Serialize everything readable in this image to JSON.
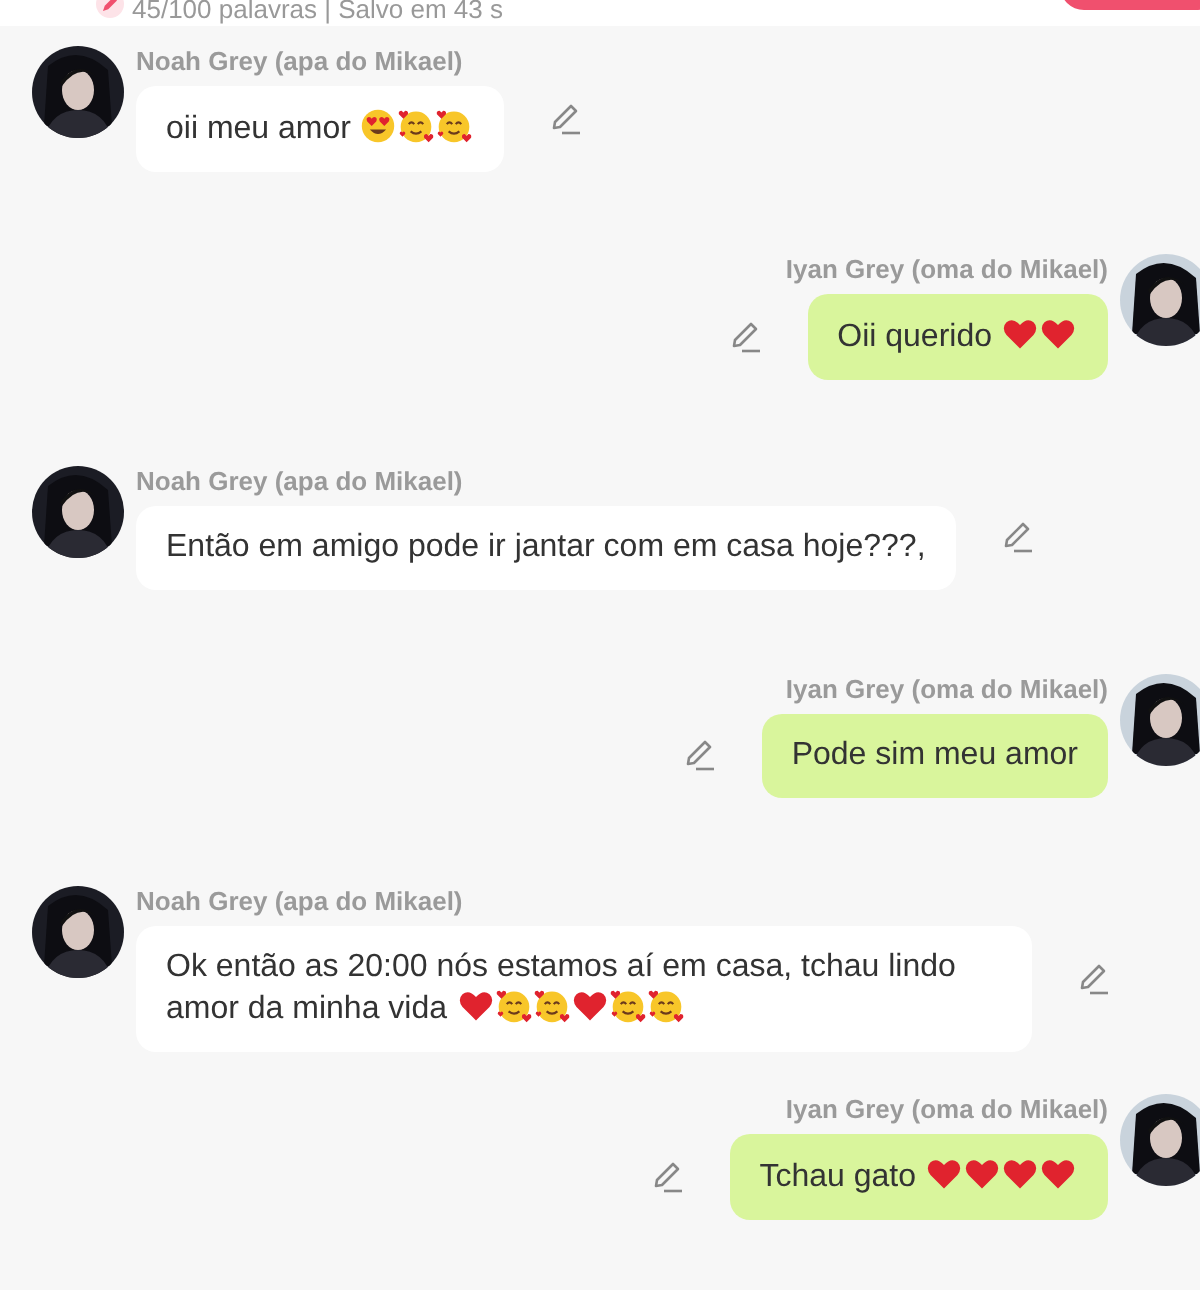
{
  "header": {
    "status": "45/100 palavras | Salvo em 43 s"
  },
  "messages": [
    {
      "kind": "received",
      "author": "Noah Grey (apa do Mikael)",
      "text": "oii meu amor",
      "emojis": [
        {
          "kind": "heart-eyes"
        },
        {
          "kind": "smiling-hearts"
        },
        {
          "kind": "smiling-hearts"
        }
      ]
    },
    {
      "kind": "sent",
      "author": "Iyan Grey (oma do Mikael)",
      "text": "Oii querido",
      "emojis": [
        {
          "kind": "heart"
        },
        {
          "kind": "heart"
        }
      ]
    },
    {
      "kind": "received",
      "author": "Noah Grey (apa do Mikael)",
      "text": "Então em amigo pode ir jantar com em casa hoje???,"
    },
    {
      "kind": "sent",
      "author": "Iyan Grey (oma do Mikael)",
      "text": "Pode sim meu amor"
    },
    {
      "kind": "received",
      "author": "Noah Grey (apa do Mikael)",
      "text": "Ok então as 20:00 nós estamos aí em casa, tchau lindo amor da minha vida",
      "emojis": [
        {
          "kind": "heart"
        },
        {
          "kind": "smiling-hearts"
        },
        {
          "kind": "smiling-hearts"
        },
        {
          "kind": "heart"
        },
        {
          "kind": "smiling-hearts"
        },
        {
          "kind": "smiling-hearts"
        }
      ]
    },
    {
      "kind": "sent",
      "author": "Iyan Grey (oma do Mikael)",
      "text": "Tchau gato",
      "emojis": [
        {
          "kind": "heart"
        },
        {
          "kind": "heart"
        },
        {
          "kind": "heart"
        },
        {
          "kind": "heart"
        }
      ]
    }
  ]
}
